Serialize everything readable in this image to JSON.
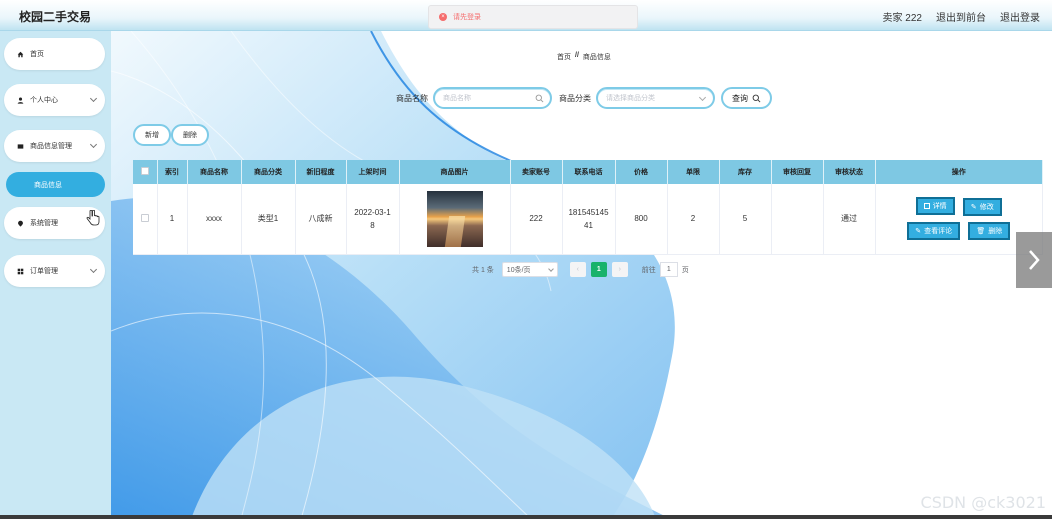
{
  "app": {
    "title": "校园二手交易"
  },
  "header": {
    "user_label": "卖家 222",
    "front_link": "退出到前台",
    "logout_link": "退出登录"
  },
  "toast": {
    "message": "请先登录"
  },
  "sidebar": {
    "items": [
      {
        "label": "首页"
      },
      {
        "label": "个人中心"
      },
      {
        "label": "商品信息管理"
      },
      {
        "label": "系统管理"
      },
      {
        "label": "订单管理"
      }
    ],
    "active_sub": "商品信息"
  },
  "breadcrumb": {
    "home": "首页",
    "sep": "//",
    "current": "商品信息"
  },
  "search": {
    "name_label": "商品名称",
    "name_placeholder": "商品名称",
    "category_label": "商品分类",
    "category_placeholder": "请选择商品分类",
    "button_label": "查询"
  },
  "actions": {
    "add": "新增",
    "delete": "删除"
  },
  "table": {
    "headers": [
      "索引",
      "商品名称",
      "商品分类",
      "新旧程度",
      "上架时间",
      "商品图片",
      "卖家账号",
      "联系电话",
      "价格",
      "单限",
      "库存",
      "审核回复",
      "审核状态",
      "操作"
    ],
    "rows": [
      {
        "index": "1",
        "name": "xxxx",
        "category": "类型1",
        "condition": "八成新",
        "time": "2022-03-18",
        "seller": "222",
        "phone": "18154514541",
        "price": "800",
        "limit": "2",
        "stock": "5",
        "reply": "",
        "status": "通过",
        "ops": {
          "detail": "详情",
          "edit": "修改",
          "comments": "查看评论",
          "delete": "删除"
        }
      }
    ]
  },
  "pagination": {
    "total": "共 1 条",
    "page_size": "10条/页",
    "current": "1",
    "goto_label": "前往",
    "goto_value": "1",
    "page_suffix": "页"
  },
  "watermark": "CSDN @ck3021",
  "colors": {
    "accent": "#33aee0",
    "header_row": "#7ec8e3",
    "pager_active": "#19b26b",
    "sidebar_bg": "#c9e8f4"
  }
}
